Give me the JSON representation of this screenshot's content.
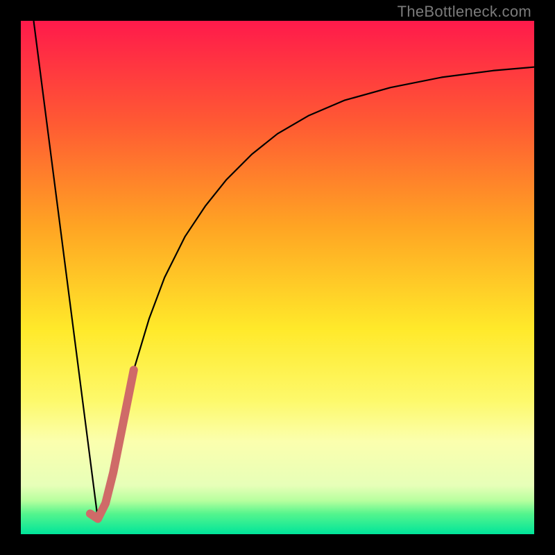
{
  "watermark": "TheBottleneck.com",
  "chart_data": {
    "type": "line",
    "title": "",
    "xlabel": "",
    "ylabel": "",
    "xlim": [
      0,
      100
    ],
    "ylim": [
      0,
      100
    ],
    "grid": false,
    "legend": false,
    "gradient_stops": [
      {
        "offset": 0.0,
        "color": "#ff1a4b"
      },
      {
        "offset": 0.2,
        "color": "#ff5a33"
      },
      {
        "offset": 0.4,
        "color": "#ffa423"
      },
      {
        "offset": 0.6,
        "color": "#ffe92a"
      },
      {
        "offset": 0.74,
        "color": "#fdf96b"
      },
      {
        "offset": 0.82,
        "color": "#fbffae"
      },
      {
        "offset": 0.905,
        "color": "#e7ffb8"
      },
      {
        "offset": 0.935,
        "color": "#b6ff9e"
      },
      {
        "offset": 0.96,
        "color": "#55f58d"
      },
      {
        "offset": 1.0,
        "color": "#00e59a"
      }
    ],
    "series": [
      {
        "name": "left-descent",
        "type": "line",
        "stroke": "#000000",
        "width": 2.2,
        "x": [
          2.5,
          15
        ],
        "y": [
          100,
          3
        ]
      },
      {
        "name": "right-curve",
        "type": "line",
        "stroke": "#000000",
        "width": 2.2,
        "x": [
          15,
          17,
          19,
          22,
          25,
          28,
          32,
          36,
          40,
          45,
          50,
          56,
          63,
          72,
          82,
          92,
          100
        ],
        "y": [
          3,
          10,
          20,
          32,
          42,
          50,
          58,
          64,
          69,
          74,
          78,
          81.5,
          84.5,
          87,
          89,
          90.3,
          91
        ]
      },
      {
        "name": "highlighted-segment",
        "type": "line",
        "stroke": "#cf6a68",
        "width": 12,
        "linecap": "round",
        "x": [
          13.5,
          15,
          16.5,
          18,
          20,
          22
        ],
        "y": [
          4,
          3,
          6,
          12,
          22,
          32
        ]
      }
    ]
  }
}
